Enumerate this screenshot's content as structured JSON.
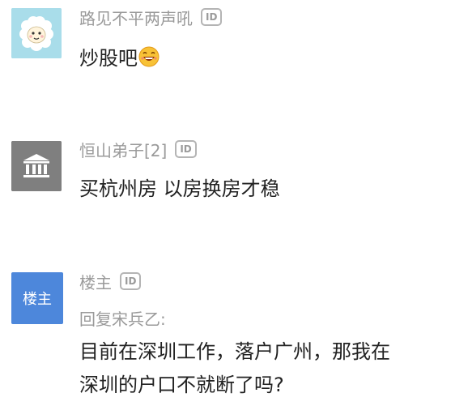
{
  "comments": [
    {
      "username": "路见不平两声吼",
      "id_badge": "ID",
      "avatar_icon": "sheep-avatar-icon",
      "content": "炒股吧",
      "emoji": "grinning-face-emoji"
    },
    {
      "username": "恒山弟子[2]",
      "id_badge": "ID",
      "avatar_icon": "bank-building-icon",
      "content": "买杭州房 以房换房才稳"
    },
    {
      "username": "楼主",
      "id_badge": "ID",
      "avatar_label": "楼主",
      "reply_to": "回复宋兵乙:",
      "content_line1": "目前在深圳工作，落户广州，那我在",
      "content_line2": "深圳的户口不就断了吗?"
    }
  ],
  "colors": {
    "username": "#9a9a9a",
    "content": "#222222",
    "owner_avatar": "#4d87db",
    "bank_avatar": "#7f7f7f",
    "sheep_avatar_bg": "#a9ddea"
  }
}
